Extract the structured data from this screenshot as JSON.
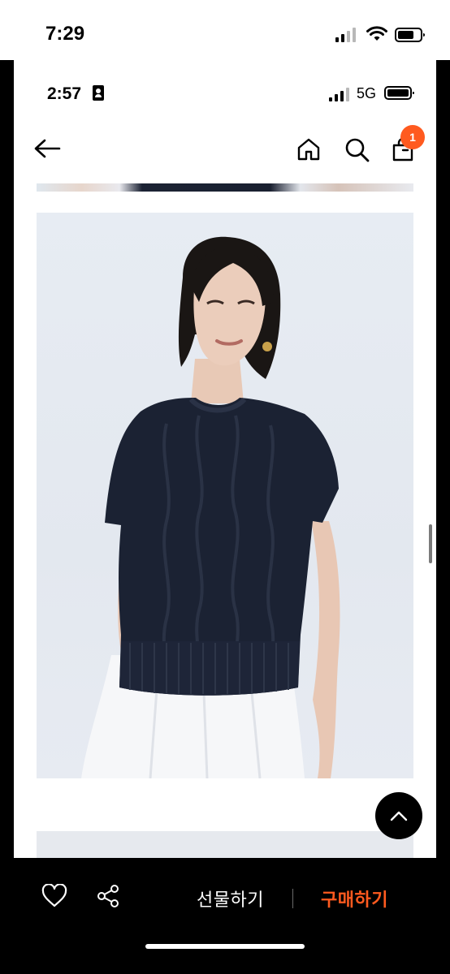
{
  "outer_status": {
    "time": "7:29",
    "battery_level": 0.72
  },
  "inner_status": {
    "time": "2:57",
    "network": "5G",
    "battery_level": 0.95
  },
  "header": {
    "back_icon": "arrow-left-icon",
    "home_icon": "home-icon",
    "search_icon": "search-icon",
    "cart_icon": "shopping-bag-icon",
    "cart_count": "1"
  },
  "product": {
    "image_description_icon": "product-photo"
  },
  "bottom_bar": {
    "wishlist_icon": "heart-icon",
    "share_icon": "share-icon",
    "gift_label": "선물하기",
    "buy_label": "구매하기"
  },
  "colors": {
    "accent": "#ff5a1f",
    "bar_background": "#000000"
  }
}
